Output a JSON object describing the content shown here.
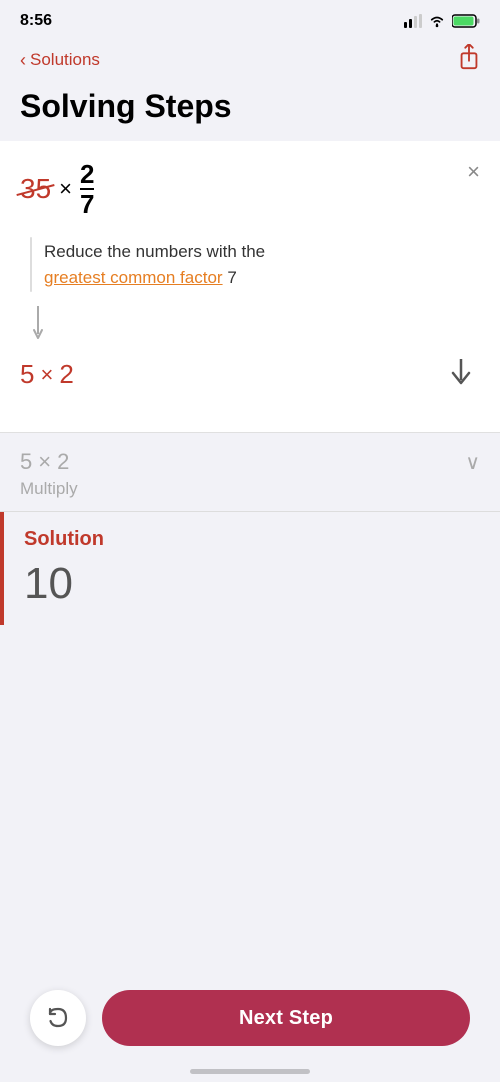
{
  "statusBar": {
    "time": "8:56",
    "indicator": "◂"
  },
  "nav": {
    "backLabel": "Solutions",
    "shareIcon": "⬆"
  },
  "pageTitle": "Solving Steps",
  "stepCard": {
    "crossedNumber": "35",
    "multiplySign": "×",
    "fraction": {
      "numerator": "2",
      "denominator": "7"
    },
    "closeIcon": "×",
    "explanation": {
      "prefix": "Reduce the numbers with the",
      "gcfLinkText": "greatest common factor",
      "suffix": "7"
    },
    "resultExpr": {
      "num1": "5",
      "multiply": "×",
      "num2": "2"
    },
    "downArrow": "↓"
  },
  "stepNext": {
    "num1": "5",
    "multiply": "×",
    "num2": "2",
    "chevron": "∨",
    "label": "Multiply"
  },
  "solution": {
    "label": "Solution",
    "value": "10"
  },
  "actions": {
    "undoIcon": "↺",
    "nextStepLabel": "Next Step"
  }
}
